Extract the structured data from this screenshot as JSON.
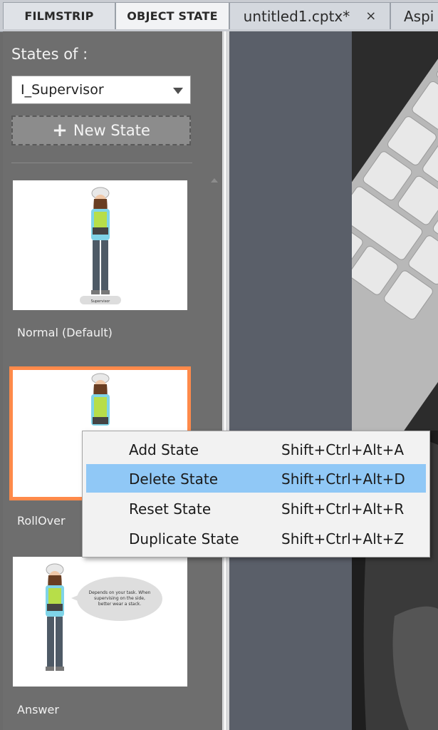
{
  "tabs": {
    "filmstrip": "FILMSTRIP",
    "object_state": "OBJECT STATE",
    "document": "untitled1.cptx*",
    "document_close": "×",
    "partial": "Aspi"
  },
  "states_panel": {
    "label": "States of :",
    "object_selected": "I_Supervisor",
    "new_state_label": "New State"
  },
  "thumbnails": [
    {
      "caption": "Normal (Default)",
      "figure_label": "Supervisor"
    },
    {
      "caption": "RollOver"
    },
    {
      "caption": "Answer",
      "bubble_text": "Depends on your task. When supervising on the side, better wear a stack."
    }
  ],
  "context_menu": {
    "items": [
      {
        "label": "Add State",
        "shortcut": "Shift+Ctrl+Alt+A"
      },
      {
        "label": "Delete State",
        "shortcut": "Shift+Ctrl+Alt+D",
        "highlighted": true
      },
      {
        "label": "Reset State",
        "shortcut": "Shift+Ctrl+Alt+R"
      },
      {
        "label": "Duplicate State",
        "shortcut": "Shift+Ctrl+Alt+Z"
      }
    ]
  },
  "colors": {
    "panel_bg": "#6e6e6e",
    "selected_outline": "#ff8a4a",
    "menu_highlight": "#90c8f6"
  }
}
